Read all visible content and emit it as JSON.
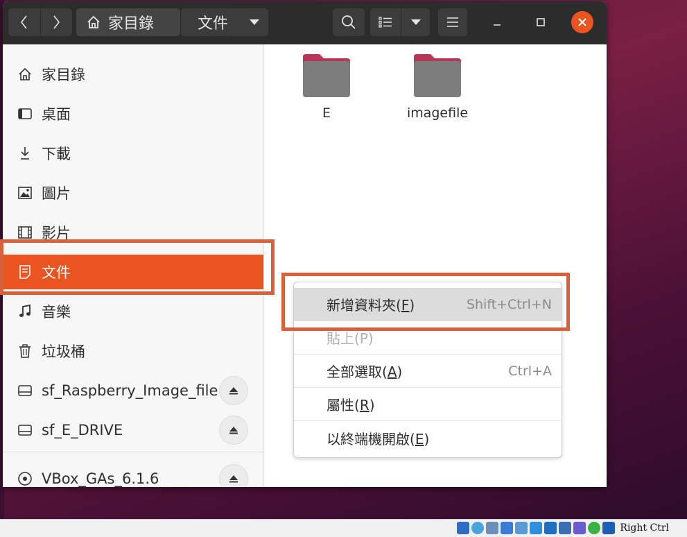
{
  "header": {
    "back_icon": "chevron-left-icon",
    "forward_icon": "chevron-right-icon",
    "path_home_label": "家目錄",
    "path_current_label": "文件",
    "search_icon": "search-icon",
    "view_icon": "list-view-icon",
    "menu_icon": "hamburger-menu-icon",
    "close_color": "#e95420"
  },
  "sidebar": {
    "items": [
      {
        "label": "家目錄",
        "icon": "home-icon"
      },
      {
        "label": "桌面",
        "icon": "desktop-icon"
      },
      {
        "label": "下載",
        "icon": "download-icon"
      },
      {
        "label": "圖片",
        "icon": "pictures-icon"
      },
      {
        "label": "影片",
        "icon": "videos-icon"
      },
      {
        "label": "文件",
        "icon": "documents-icon",
        "active": true
      },
      {
        "label": "音樂",
        "icon": "music-icon"
      },
      {
        "label": "垃圾桶",
        "icon": "trash-icon"
      },
      {
        "label": "sf_Raspberry_Image_file",
        "icon": "drive-icon"
      },
      {
        "label": "sf_E_DRIVE",
        "icon": "drive-icon"
      },
      {
        "label": "VBox_GAs_6.1.6",
        "icon": "disc-icon"
      }
    ],
    "accent_color": "#e95420"
  },
  "content": {
    "folders": [
      {
        "name": "E"
      },
      {
        "name": "imagefile"
      }
    ]
  },
  "context_menu": {
    "items": [
      {
        "label": "新增資料夾(",
        "mnemonic": "F",
        "suffix": ")",
        "accel": "Shift+Ctrl+N"
      },
      {
        "label": "貼上(P)",
        "mnemonic": "",
        "suffix": "",
        "accel": "",
        "disabled": true
      },
      {
        "label": "全部選取(",
        "mnemonic": "A",
        "suffix": ")",
        "accel": "Ctrl+A"
      },
      {
        "label": "屬性(",
        "mnemonic": "R",
        "suffix": ")",
        "accel": ""
      },
      {
        "label": "以終端機開啟(",
        "mnemonic": "E",
        "suffix": ")",
        "accel": ""
      }
    ]
  },
  "statusbar": {
    "host_key": "Right Ctrl"
  }
}
